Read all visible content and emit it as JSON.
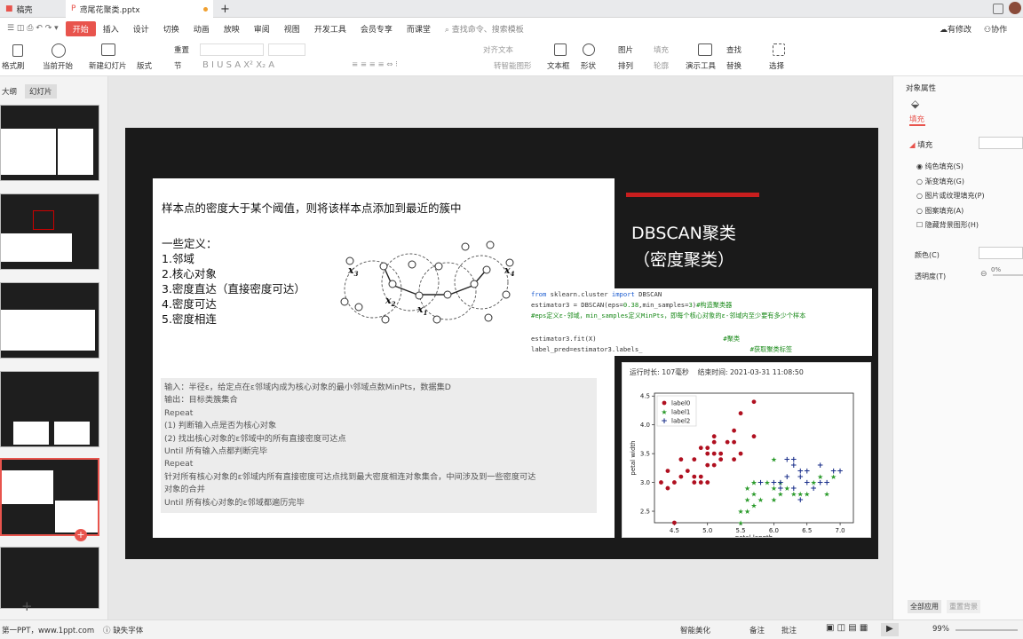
{
  "tabs": {
    "home": "稿壳",
    "doc": "鸢尾花聚类.pptx",
    "add": "+"
  },
  "menu": [
    "开始",
    "插入",
    "设计",
    "切换",
    "动画",
    "放映",
    "审阅",
    "视图",
    "开发工具",
    "会员专享",
    "而课堂"
  ],
  "search": {
    "placeholder": "查找命令、搜索模板"
  },
  "topright": {
    "modify": "有修改",
    "collab": "协作"
  },
  "ribbon": {
    "format_painter": "格式刷",
    "play": "当前开始",
    "new_slide": "新建幻灯片",
    "layout": "版式",
    "section": "节",
    "reset": "重置",
    "align_text": "对齐文本",
    "smart_art": "转智能图形",
    "textbox": "文本框",
    "shape": "形状",
    "arrange": "排列",
    "picture": "图片",
    "fill": "填充",
    "outline": "轮廓",
    "presenter": "演示工具",
    "find": "查找",
    "replace": "替换",
    "select": "选择"
  },
  "sidepanel": {
    "outline": "大纲",
    "slides": "幻灯片",
    "add": "+"
  },
  "slide": {
    "main_text": "样本点的密度大于某个阈值，则将该样本点添加到最近的簇中",
    "defs": [
      "一些定义：",
      "1.邻域",
      "2.核心对象",
      "3.密度直达（直接密度可达）",
      "4.密度可达",
      "5.密度相连"
    ],
    "title_l1": "DBSCAN聚类",
    "title_l2": "（密度聚类）",
    "algo": [
      "输入：半径ε，给定点在ε邻域内成为核心对象的最小邻域点数MinPts，数据集D",
      "输出：目标类簇集合",
      "Repeat",
      "(1) 判断输入点是否为核心对象",
      "(2) 找出核心对象的ε邻域中的所有直接密度可达点",
      "Until 所有输入点都判断完毕",
      "Repeat",
      "针对所有核心对象的ε邻域内所有直接密度可达点找到最大密度相连对象集合，中间涉及到一些密度可达",
      "对象的合并",
      "Until 所有核心对象的ε邻域都遍历完毕"
    ],
    "code": [
      "from sklearn.cluster import DBSCAN",
      "estimator3 = DBSCAN(eps=0.38,min_samples=3)#构造聚类器",
      "#eps定义ε-邻域，min_samples定义MinPts，即每个核心对象的ε-邻域内至少要有多少个样本",
      "",
      "estimator3.fit(X)                                   #聚类",
      "label_pred=estimator3.labels_                              #获取聚类标签"
    ],
    "run_info": "运行时长: 107毫秒    结束时间: 2021-03-31 11:08:50",
    "diagram": {
      "x1": "x",
      "x1s": "1",
      "x2": "x",
      "x2s": "2",
      "x3": "x",
      "x3s": "3",
      "x4": "x",
      "x4s": "4"
    }
  },
  "chart_data": {
    "type": "scatter",
    "xlabel": "petal length",
    "ylabel": "petal width",
    "xlim": [
      4.2,
      7.2
    ],
    "ylim": [
      2.3,
      4.55
    ],
    "xticks": [
      "4.5",
      "5.0",
      "5.5",
      "6.0",
      "6.5",
      "7.0"
    ],
    "yticks": [
      "2.5",
      "3.0",
      "3.5",
      "4.0",
      "4.5"
    ],
    "legend_pos": "top-left",
    "series": [
      {
        "name": "label0",
        "color": "#b01020",
        "marker": "o",
        "points": [
          [
            4.3,
            3.0
          ],
          [
            4.4,
            2.9
          ],
          [
            4.4,
            3.2
          ],
          [
            4.5,
            3.0
          ],
          [
            4.6,
            3.1
          ],
          [
            4.6,
            3.4
          ],
          [
            4.7,
            3.2
          ],
          [
            4.8,
            3.0
          ],
          [
            4.8,
            3.4
          ],
          [
            4.9,
            3.0
          ],
          [
            4.9,
            3.1
          ],
          [
            4.9,
            3.6
          ],
          [
            5.0,
            3.0
          ],
          [
            5.0,
            3.3
          ],
          [
            5.0,
            3.5
          ],
          [
            5.1,
            3.3
          ],
          [
            5.1,
            3.5
          ],
          [
            5.1,
            3.8
          ],
          [
            5.2,
            3.4
          ],
          [
            5.2,
            3.5
          ],
          [
            5.3,
            3.7
          ],
          [
            5.4,
            3.4
          ],
          [
            5.4,
            3.7
          ],
          [
            5.4,
            3.9
          ],
          [
            5.5,
            3.5
          ],
          [
            5.5,
            4.2
          ],
          [
            5.7,
            3.8
          ],
          [
            5.7,
            4.4
          ],
          [
            4.8,
            3.1
          ],
          [
            5.0,
            3.6
          ],
          [
            5.1,
            3.7
          ],
          [
            4.5,
            2.3
          ]
        ]
      },
      {
        "name": "label1",
        "color": "#2a9a2a",
        "marker": "*",
        "points": [
          [
            5.5,
            2.3
          ],
          [
            5.5,
            2.5
          ],
          [
            5.6,
            2.5
          ],
          [
            5.6,
            2.7
          ],
          [
            5.6,
            2.9
          ],
          [
            5.7,
            2.6
          ],
          [
            5.7,
            2.8
          ],
          [
            5.7,
            3.0
          ],
          [
            5.8,
            2.7
          ],
          [
            5.9,
            3.0
          ],
          [
            6.0,
            2.7
          ],
          [
            6.0,
            2.9
          ],
          [
            6.1,
            2.8
          ],
          [
            6.1,
            3.0
          ],
          [
            6.2,
            2.9
          ],
          [
            6.3,
            2.8
          ],
          [
            6.4,
            2.8
          ],
          [
            6.5,
            2.8
          ],
          [
            6.6,
            3.0
          ],
          [
            6.7,
            3.1
          ],
          [
            6.8,
            2.8
          ],
          [
            5.7,
            3.0
          ],
          [
            6.0,
            3.4
          ],
          [
            6.9,
            3.1
          ]
        ]
      },
      {
        "name": "label2",
        "color": "#1a2f8a",
        "marker": "+",
        "points": [
          [
            5.8,
            3.0
          ],
          [
            6.0,
            3.0
          ],
          [
            6.1,
            3.0
          ],
          [
            6.2,
            3.1
          ],
          [
            6.3,
            2.9
          ],
          [
            6.3,
            3.3
          ],
          [
            6.4,
            3.1
          ],
          [
            6.4,
            3.2
          ],
          [
            6.5,
            3.0
          ],
          [
            6.5,
            3.2
          ],
          [
            6.7,
            3.0
          ],
          [
            6.7,
            3.3
          ],
          [
            6.8,
            3.0
          ],
          [
            6.9,
            3.2
          ],
          [
            7.0,
            3.2
          ],
          [
            6.3,
            3.4
          ],
          [
            6.2,
            3.4
          ],
          [
            6.1,
            2.9
          ],
          [
            6.6,
            2.9
          ],
          [
            6.4,
            2.7
          ]
        ]
      }
    ]
  },
  "rightpanel": {
    "title": "对象属性",
    "fill_tab": "填充",
    "fill": "填充",
    "opts": [
      "纯色填充(S)",
      "渐变填充(G)",
      "图片或纹理填充(P)",
      "图案填充(A)",
      "隐藏背景图形(H)"
    ],
    "color": "颜色(C)",
    "transparency": "透明度(T)",
    "pct": "0%",
    "apply_all": "全部应用",
    "reset_bg": "重置背景"
  },
  "status": {
    "left": "第一PPT，www.1ppt.com",
    "missing_font": "缺失字体",
    "smart": "智能美化",
    "notes": "备注",
    "comment": "批注",
    "zoom": "99%"
  }
}
